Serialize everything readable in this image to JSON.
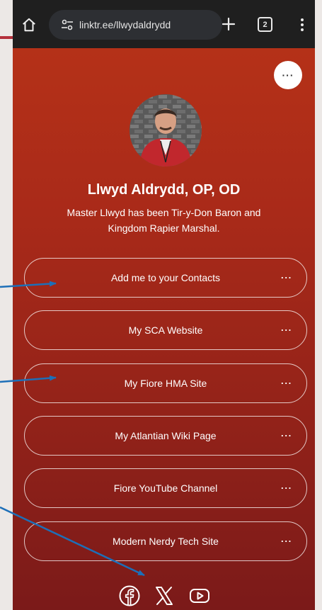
{
  "browser": {
    "url": "linktr.ee/llwydaldrydd",
    "tab_count": "2"
  },
  "profile": {
    "name": "Llwyd Aldrydd, OP, OD",
    "bio": "Master Llwyd has been Tir-y-Don Baron and Kingdom Rapier Marshal.",
    "more_label": "···"
  },
  "links": [
    {
      "label": "Add me to your Contacts",
      "more": "···"
    },
    {
      "label": "My SCA Website",
      "more": "···"
    },
    {
      "label": "My Fiore HMA Site",
      "more": "···"
    },
    {
      "label": "My Atlantian Wiki Page",
      "more": "···"
    },
    {
      "label": "Fiore YouTube Channel",
      "more": "···"
    },
    {
      "label": "Modern Nerdy Tech Site",
      "more": "···"
    }
  ],
  "social": [
    "facebook-icon",
    "x-icon",
    "youtube-icon"
  ],
  "colors": {
    "gradient_top": "#b83318",
    "gradient_bottom": "#7b1a19",
    "arrow": "#1d6fb8",
    "browser_bar": "#1f1f1f"
  }
}
